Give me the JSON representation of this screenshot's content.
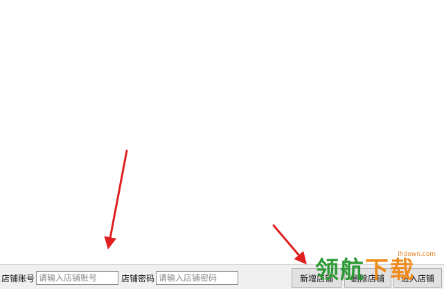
{
  "bottom_bar": {
    "account_label": "店铺账号",
    "account_placeholder": "请输入店铺账号",
    "password_label": "店铺密码",
    "password_placeholder": "请输入店铺密码",
    "add_store_label": "新增店铺",
    "delete_store_label": "删除店铺",
    "enter_store_label": "进入店铺"
  },
  "watermark": {
    "domain": "lhdown.com",
    "chars": [
      "领",
      "航",
      "下",
      "载"
    ]
  },
  "colors": {
    "annotation_arrow": "#e02020",
    "bar_background": "#f0f0f0",
    "watermark_green": "#2c9a34",
    "watermark_orange": "#ef8a1c"
  },
  "icons": [
    "annotation-arrow-1",
    "annotation-arrow-2"
  ]
}
